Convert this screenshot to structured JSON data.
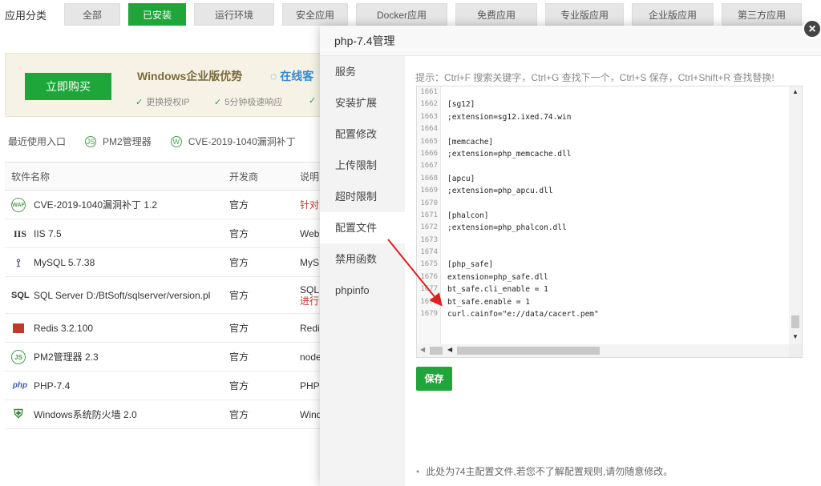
{
  "categories": {
    "label": "应用分类",
    "items": [
      "全部",
      "已安装",
      "运行环境",
      "安全应用",
      "Docker应用",
      "免费应用",
      "专业版应用",
      "企业版应用",
      "第三方应用"
    ]
  },
  "promo": {
    "buy": "立即购买",
    "title": "Windows企业版优势",
    "online": "在线客",
    "feat1": "更换授权IP",
    "feat2": "5分钟极速响应"
  },
  "recent": {
    "label": "最近使用入口",
    "items": [
      "PM2管理器",
      "CVE-2019-1040漏洞补丁"
    ]
  },
  "table": {
    "headers": {
      "name": "软件名称",
      "dev": "开发商",
      "desc": "说明"
    },
    "rows": [
      {
        "name": "CVE-2019-1040漏洞补丁 1.2",
        "dev": "官方",
        "desc": "针对",
        "icon": "WAF"
      },
      {
        "name": "IIS 7.5",
        "dev": "官方",
        "desc": "Web",
        "icon": "IIS"
      },
      {
        "name": "MySQL 5.7.38",
        "dev": "官方",
        "desc": "MyS",
        "icon": "dolphin"
      },
      {
        "name": "SQL Server D:/BtSoft/sqlserver/version.pl",
        "dev": "官方",
        "desc": "SQL",
        "desc2": "进行",
        "icon": "SQL"
      },
      {
        "name": "Redis 3.2.100",
        "dev": "官方",
        "desc": "Redi",
        "icon": "redis"
      },
      {
        "name": "PM2管理器 2.3",
        "dev": "官方",
        "desc": "node",
        "icon": "JS"
      },
      {
        "name": "PHP-7.4",
        "dev": "官方",
        "desc": "PHP",
        "icon": "php"
      },
      {
        "name": "Windows系统防火墙 2.0",
        "dev": "官方",
        "desc": "Wind",
        "icon": "shield"
      }
    ]
  },
  "modal": {
    "title": "php-7.4管理",
    "close": "×",
    "nav": [
      "服务",
      "安装扩展",
      "配置修改",
      "上传限制",
      "超时限制",
      "配置文件",
      "禁用函数",
      "phpinfo"
    ],
    "active_nav": "配置文件",
    "tip": "提示：Ctrl+F 搜索关键字，Ctrl+G 查找下一个，Ctrl+S 保存，Ctrl+Shift+R 查找替换!",
    "save": "保存",
    "note": "此处为74主配置文件,若您不了解配置规则,请勿随意修改。"
  },
  "editor": {
    "lines": [
      {
        "n": "1661",
        "t": ""
      },
      {
        "n": "1662",
        "t": "[sg12]"
      },
      {
        "n": "1663",
        "t": ";extension=sg12.ixed.74.win"
      },
      {
        "n": "1664",
        "t": ""
      },
      {
        "n": "1665",
        "t": "[memcache]"
      },
      {
        "n": "1666",
        "t": ";extension=php_memcache.dll"
      },
      {
        "n": "1667",
        "t": ""
      },
      {
        "n": "1668",
        "t": "[apcu]"
      },
      {
        "n": "1669",
        "t": ";extension=php_apcu.dll"
      },
      {
        "n": "1670",
        "t": ""
      },
      {
        "n": "1671",
        "t": "[phalcon]"
      },
      {
        "n": "1672",
        "t": ";extension=php_phalcon.dll"
      },
      {
        "n": "1673",
        "t": ""
      },
      {
        "n": "1674",
        "t": ""
      },
      {
        "n": "1675",
        "t": "[php_safe]"
      },
      {
        "n": "1676",
        "t": "extension=php_safe.dll"
      },
      {
        "n": "1677",
        "t": "bt_safe.cli_enable = 1"
      },
      {
        "n": "1678",
        "t": "bt_safe.enable = 1"
      },
      {
        "n": "1679",
        "t": "curl.cainfo=\"e://data/cacert.pem\""
      }
    ]
  },
  "colors": {
    "accent": "#20a53a",
    "arrow": "#e02020"
  }
}
